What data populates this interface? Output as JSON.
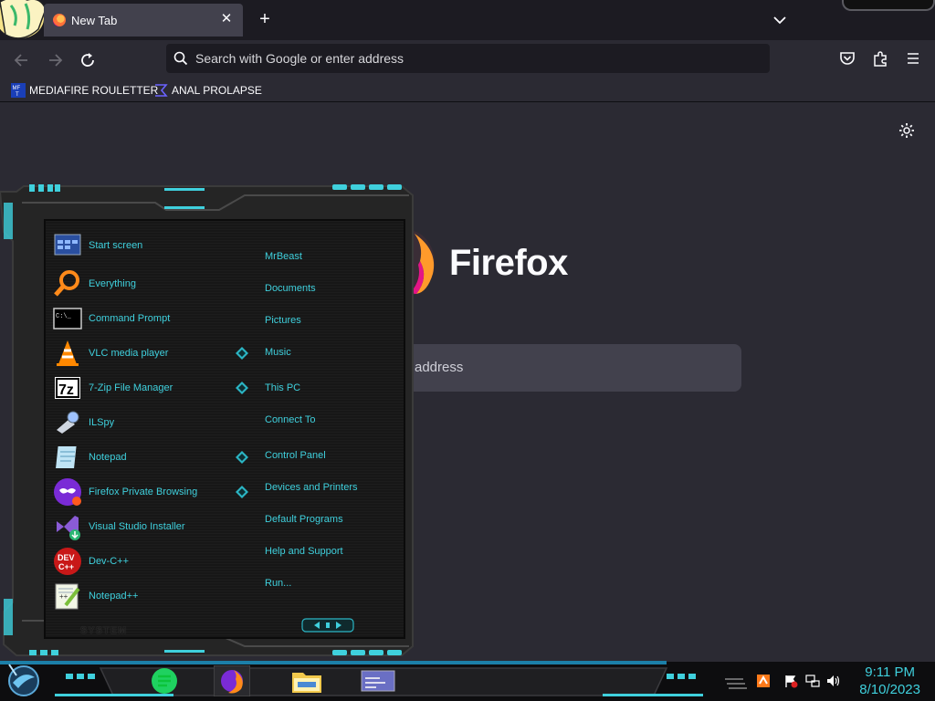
{
  "browser": {
    "tab": {
      "title": "New Tab",
      "close_glyph": "✕"
    },
    "new_tab_glyph": "+",
    "urlbar": {
      "placeholder": "Search with Google or enter address"
    },
    "bookmarks": [
      {
        "label": "MEDIAFIRE ROULETTER",
        "icon": "mediafire-favicon"
      },
      {
        "label": "ANAL PROLAPSE",
        "icon": "bookmark-favicon"
      }
    ]
  },
  "newtab": {
    "wordmark": "Firefox",
    "search_text": "address"
  },
  "start_menu": {
    "left_items": [
      {
        "label": "Start screen",
        "icon": "start-screen-icon"
      },
      {
        "label": "Everything",
        "icon": "everything-icon"
      },
      {
        "label": "Command Prompt",
        "icon": "command-prompt-icon"
      },
      {
        "label": "VLC media player",
        "icon": "vlc-icon"
      },
      {
        "label": "7-Zip File Manager",
        "icon": "7zip-icon"
      },
      {
        "label": "ILSpy",
        "icon": "ilspy-icon"
      },
      {
        "label": "Notepad",
        "icon": "notepad-icon"
      },
      {
        "label": "Firefox Private Browsing",
        "icon": "firefox-private-icon"
      },
      {
        "label": "Visual Studio Installer",
        "icon": "visual-studio-installer-icon"
      },
      {
        "label": "Dev-C++",
        "icon": "dev-cpp-icon"
      },
      {
        "label": "Notepad++",
        "icon": "notepad-plus-plus-icon"
      }
    ],
    "right_items": [
      {
        "label": "MrBeast"
      },
      {
        "label": "Documents"
      },
      {
        "label": "Pictures"
      },
      {
        "label": "Music"
      },
      {
        "label": "This PC"
      },
      {
        "label": "Connect To"
      },
      {
        "label": "Control Panel"
      },
      {
        "label": "Devices and Printers"
      },
      {
        "label": "Default Programs"
      },
      {
        "label": "Help and Support"
      },
      {
        "label": "Run..."
      }
    ],
    "system_label": "SYSTEM",
    "accent": "#3fd0dd"
  },
  "taskbar": {
    "pinned": [
      "notes-app-icon",
      "firefox-icon",
      "file-explorer-icon",
      "window-icon"
    ],
    "clock": {
      "time": "9:11 PM",
      "date": "8/10/2023"
    }
  },
  "colors": {
    "accent_cyan": "#3fd0dd",
    "browser_bg": "#2b2a33",
    "tabbar_bg": "#1c1b22"
  }
}
